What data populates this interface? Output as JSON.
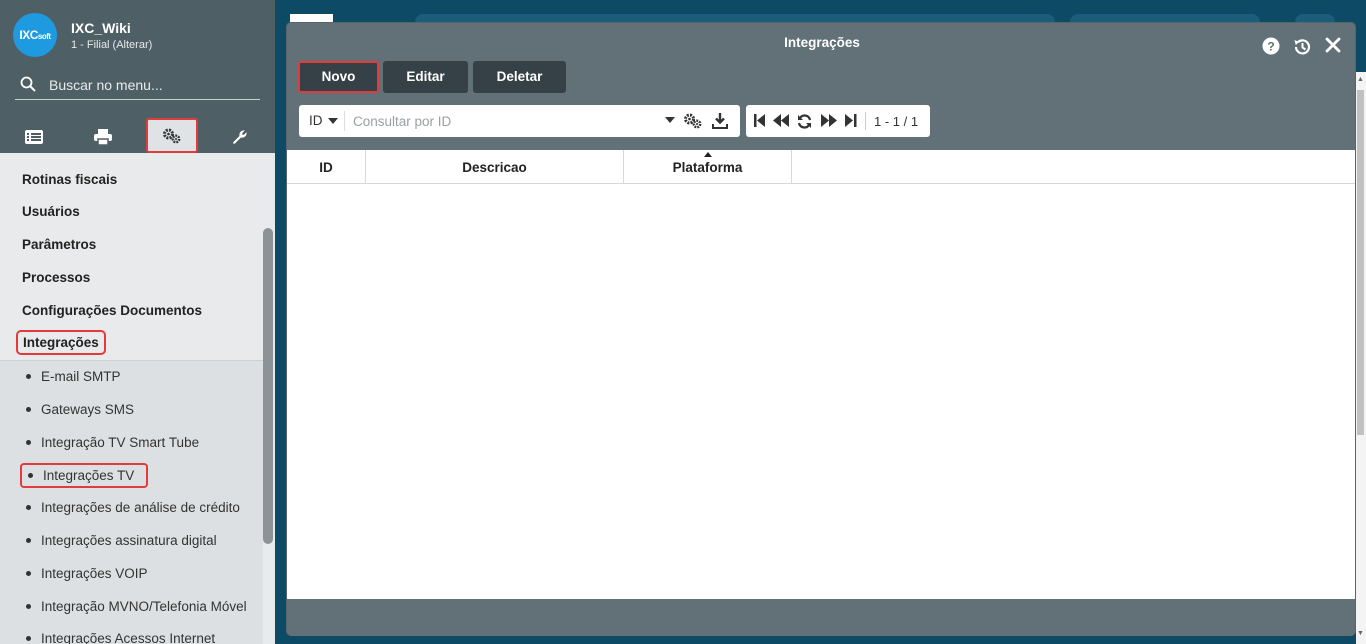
{
  "app": {
    "logo_text": "IXC",
    "logo_small": "soft",
    "title": "IXC_Wiki",
    "subtitle": "1 - Filial (Alterar)"
  },
  "sidebar": {
    "search_placeholder": "Buscar no menu...",
    "tab_icons": [
      "list-icon",
      "printer-icon",
      "gears-icon",
      "wrench-icon"
    ],
    "active_tab": "gears-icon",
    "groups": [
      {
        "label": "Rotinas fiscais"
      },
      {
        "label": "Usuários"
      },
      {
        "label": "Parâmetros"
      },
      {
        "label": "Processos"
      },
      {
        "label": "Configurações Documentos"
      },
      {
        "label": "Integrações"
      }
    ],
    "sub_items": [
      {
        "label": "E-mail SMTP"
      },
      {
        "label": "Gateways SMS"
      },
      {
        "label": "Integração TV Smart Tube"
      },
      {
        "label": "Integrações TV"
      },
      {
        "label": "Integrações de análise de crédito"
      },
      {
        "label": "Integrações assinatura digital"
      },
      {
        "label": "Integrações VOIP"
      },
      {
        "label": "Integração MVNO/Telefonia Móvel"
      },
      {
        "label": "Integrações Acessos Internet"
      }
    ]
  },
  "window": {
    "title": "Integrações",
    "toolbar": {
      "new_label": "Novo",
      "edit_label": "Editar",
      "delete_label": "Deletar"
    },
    "search": {
      "field_label": "ID",
      "placeholder": "Consultar por ID"
    },
    "pager": {
      "range_text": "1 - 1 / 1"
    },
    "table": {
      "columns": [
        "ID",
        "Descricao",
        "Plataforma"
      ],
      "sorted_column": "Plataforma",
      "rows": []
    }
  },
  "colors": {
    "sidebar_header": "#4f5f66",
    "modal": "#627078",
    "button": "#354146",
    "highlight": "#e23b3b",
    "logo": "#1e9be0",
    "background": "#0c4a66"
  }
}
